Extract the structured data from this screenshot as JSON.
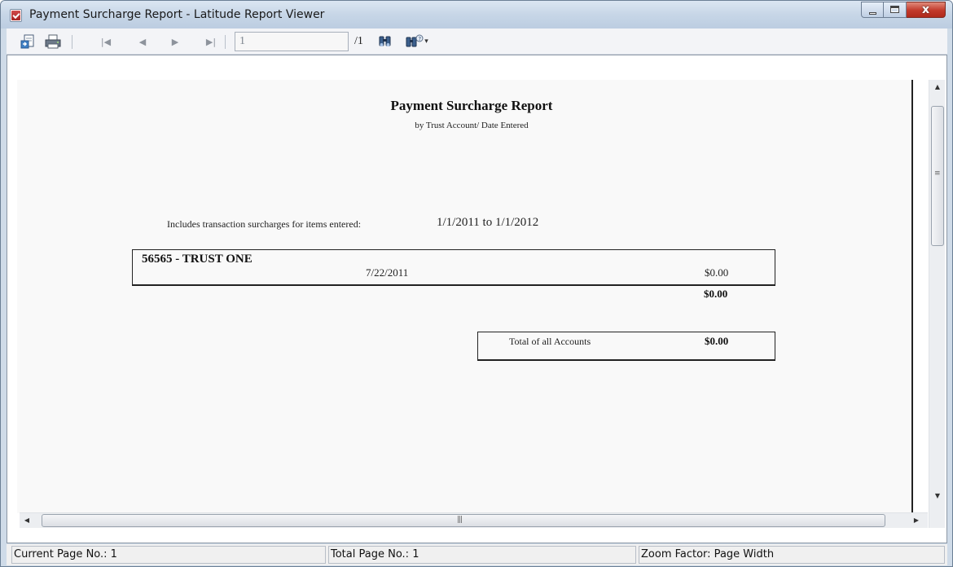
{
  "window": {
    "title": "Payment Surcharge Report - Latitude Report Viewer",
    "close_glyph": "x"
  },
  "toolbar": {
    "page_input_value": "1",
    "page_total": "/1",
    "icons": [
      "export-icon",
      "print-icon",
      "first-page-icon",
      "previous-page-icon",
      "next-page-icon",
      "last-page-icon",
      "find-icon",
      "find-dropdown-icon"
    ]
  },
  "report": {
    "title": "Payment Surcharge Report",
    "subtitle": "by Trust Account/ Date Entered",
    "includes_label": "Includes transaction surcharges for items entered:",
    "date_range": "1/1/2011 to 1/1/2012",
    "account": {
      "name": "56565 - TRUST ONE",
      "date": "7/22/2011",
      "amount": "$0.00"
    },
    "account_subtotal": "$0.00",
    "total_label": "Total of all Accounts",
    "total_amount": "$0.00"
  },
  "statusbar": {
    "current_page": "Current Page No.: 1",
    "total_page": "Total Page No.: 1",
    "zoom": "Zoom Factor: Page Width"
  }
}
